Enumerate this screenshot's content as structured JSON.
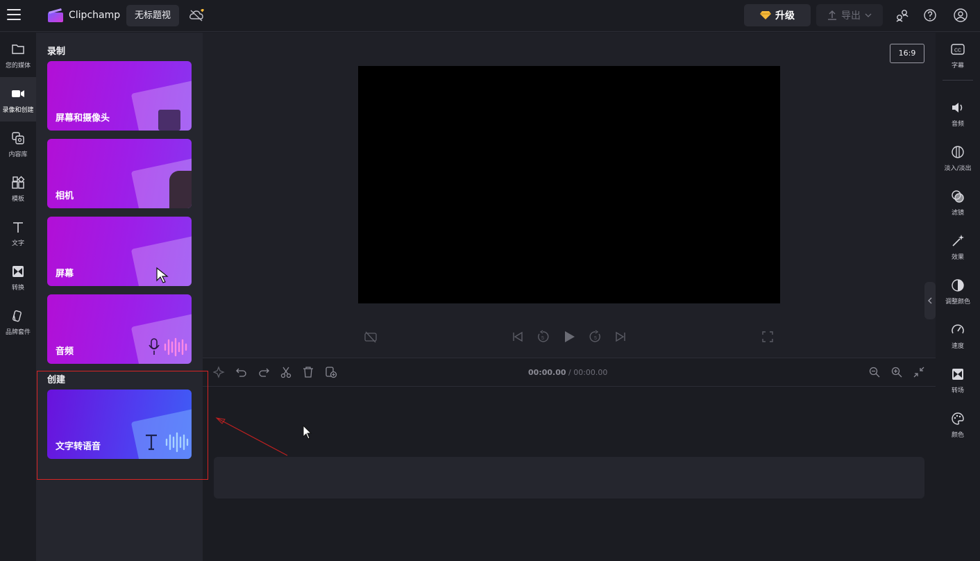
{
  "header": {
    "app_name": "Clipchamp",
    "project_title": "无标题视",
    "upgrade_label": "升级",
    "export_label": "导出"
  },
  "left_nav": [
    {
      "label": "您的媒体",
      "icon": "folder-icon"
    },
    {
      "label": "录像和创建",
      "icon": "video-camera-icon"
    },
    {
      "label": "内容库",
      "icon": "content-library-icon"
    },
    {
      "label": "模板",
      "icon": "templates-icon"
    },
    {
      "label": "文字",
      "icon": "text-icon"
    },
    {
      "label": "转换",
      "icon": "transitions-icon"
    },
    {
      "label": "品牌套件",
      "icon": "brand-kit-icon"
    }
  ],
  "panel": {
    "record_heading": "录制",
    "record_cards": [
      {
        "label": "屏幕和摄像头"
      },
      {
        "label": "相机"
      },
      {
        "label": "屏幕"
      },
      {
        "label": "音频"
      }
    ],
    "create_heading": "创建",
    "create_cards": [
      {
        "label": "文字转语音"
      }
    ]
  },
  "preview": {
    "aspect_ratio": "16:9"
  },
  "timeline": {
    "current_time": "00:00.00",
    "separator": " / ",
    "total_time": "00:00.00"
  },
  "right_nav": [
    {
      "label": "字幕",
      "icon": "captions-icon"
    },
    {
      "label": "音频",
      "icon": "speaker-icon"
    },
    {
      "label": "淡入/淡出",
      "icon": "fade-icon"
    },
    {
      "label": "滤镜",
      "icon": "filters-icon"
    },
    {
      "label": "效果",
      "icon": "effects-wand-icon"
    },
    {
      "label": "调整颜色",
      "icon": "adjust-color-icon"
    },
    {
      "label": "速度",
      "icon": "speed-gauge-icon"
    },
    {
      "label": "转场",
      "icon": "transition-icon"
    },
    {
      "label": "颜色",
      "icon": "palette-icon"
    }
  ],
  "colors": {
    "accent_purple": "#a21ce0",
    "annotation_red": "#d82424",
    "gem_gold": "#f5b93a"
  }
}
